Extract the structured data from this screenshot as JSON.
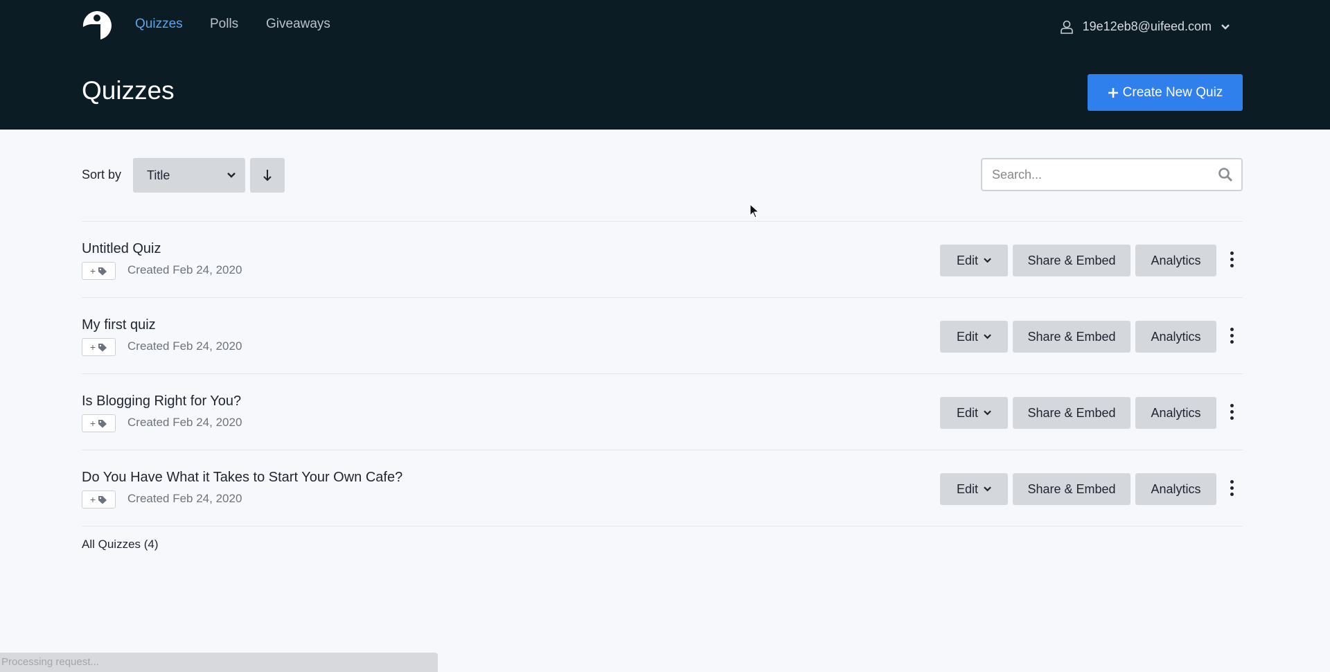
{
  "nav": {
    "items": [
      {
        "label": "Quizzes",
        "active": true
      },
      {
        "label": "Polls",
        "active": false
      },
      {
        "label": "Giveaways",
        "active": false
      }
    ]
  },
  "user": {
    "email": "19e12eb8@uifeed.com"
  },
  "header": {
    "title": "Quizzes",
    "create_label": "Create New Quiz"
  },
  "toolbar": {
    "sort_label": "Sort by",
    "sort_value": "Title",
    "search_placeholder": "Search..."
  },
  "quizzes": [
    {
      "title": "Untitled Quiz",
      "created": "Created Feb 24, 2020"
    },
    {
      "title": "My first quiz",
      "created": "Created Feb 24, 2020"
    },
    {
      "title": "Is Blogging Right for You?",
      "created": "Created Feb 24, 2020"
    },
    {
      "title": "Do You Have What it Takes to Start Your Own Cafe?",
      "created": "Created Feb 24, 2020"
    }
  ],
  "actions": {
    "edit": "Edit",
    "share": "Share & Embed",
    "analytics": "Analytics",
    "tag_plus": "+"
  },
  "footer": {
    "count": "All Quizzes (4)"
  },
  "status": {
    "text": "Processing request..."
  },
  "colors": {
    "header_bg": "#0c1c25",
    "accent": "#2f80ed",
    "nav_active": "#5aa4e6"
  }
}
